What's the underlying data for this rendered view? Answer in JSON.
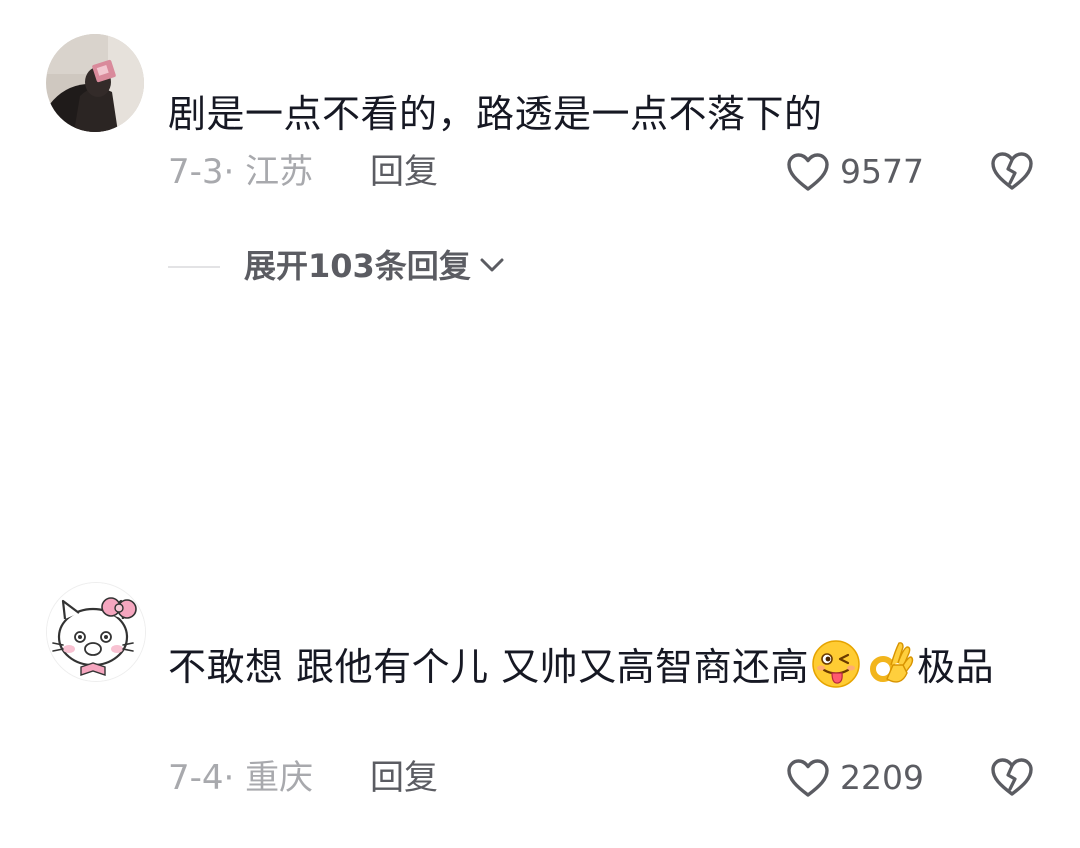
{
  "comments": [
    {
      "avatar": "user-photo-avatar",
      "text": "剧是一点不看的，路透是一点不落下的",
      "date_location": "7-3· 江苏",
      "reply_label": "回复",
      "like_count": "9577",
      "expand_replies_label": "展开103条回复"
    },
    {
      "avatar": "hello-kitty-avatar",
      "text_part1": "不敢想 跟他有个儿 又帅又高智商还高",
      "emojis": [
        "winking-tongue-emoji",
        "ok-hand-emoji"
      ],
      "text_part2": "极品",
      "date_location": "7-4· 重庆",
      "reply_label": "回复",
      "like_count": "2209"
    }
  ],
  "icons": {
    "like": "heart-outline-icon",
    "dislike": "broken-heart-icon",
    "expand": "chevron-down-icon"
  },
  "colors": {
    "text_primary": "#161823",
    "text_secondary": "#5b5c62",
    "text_tertiary": "#a8a9ad"
  }
}
